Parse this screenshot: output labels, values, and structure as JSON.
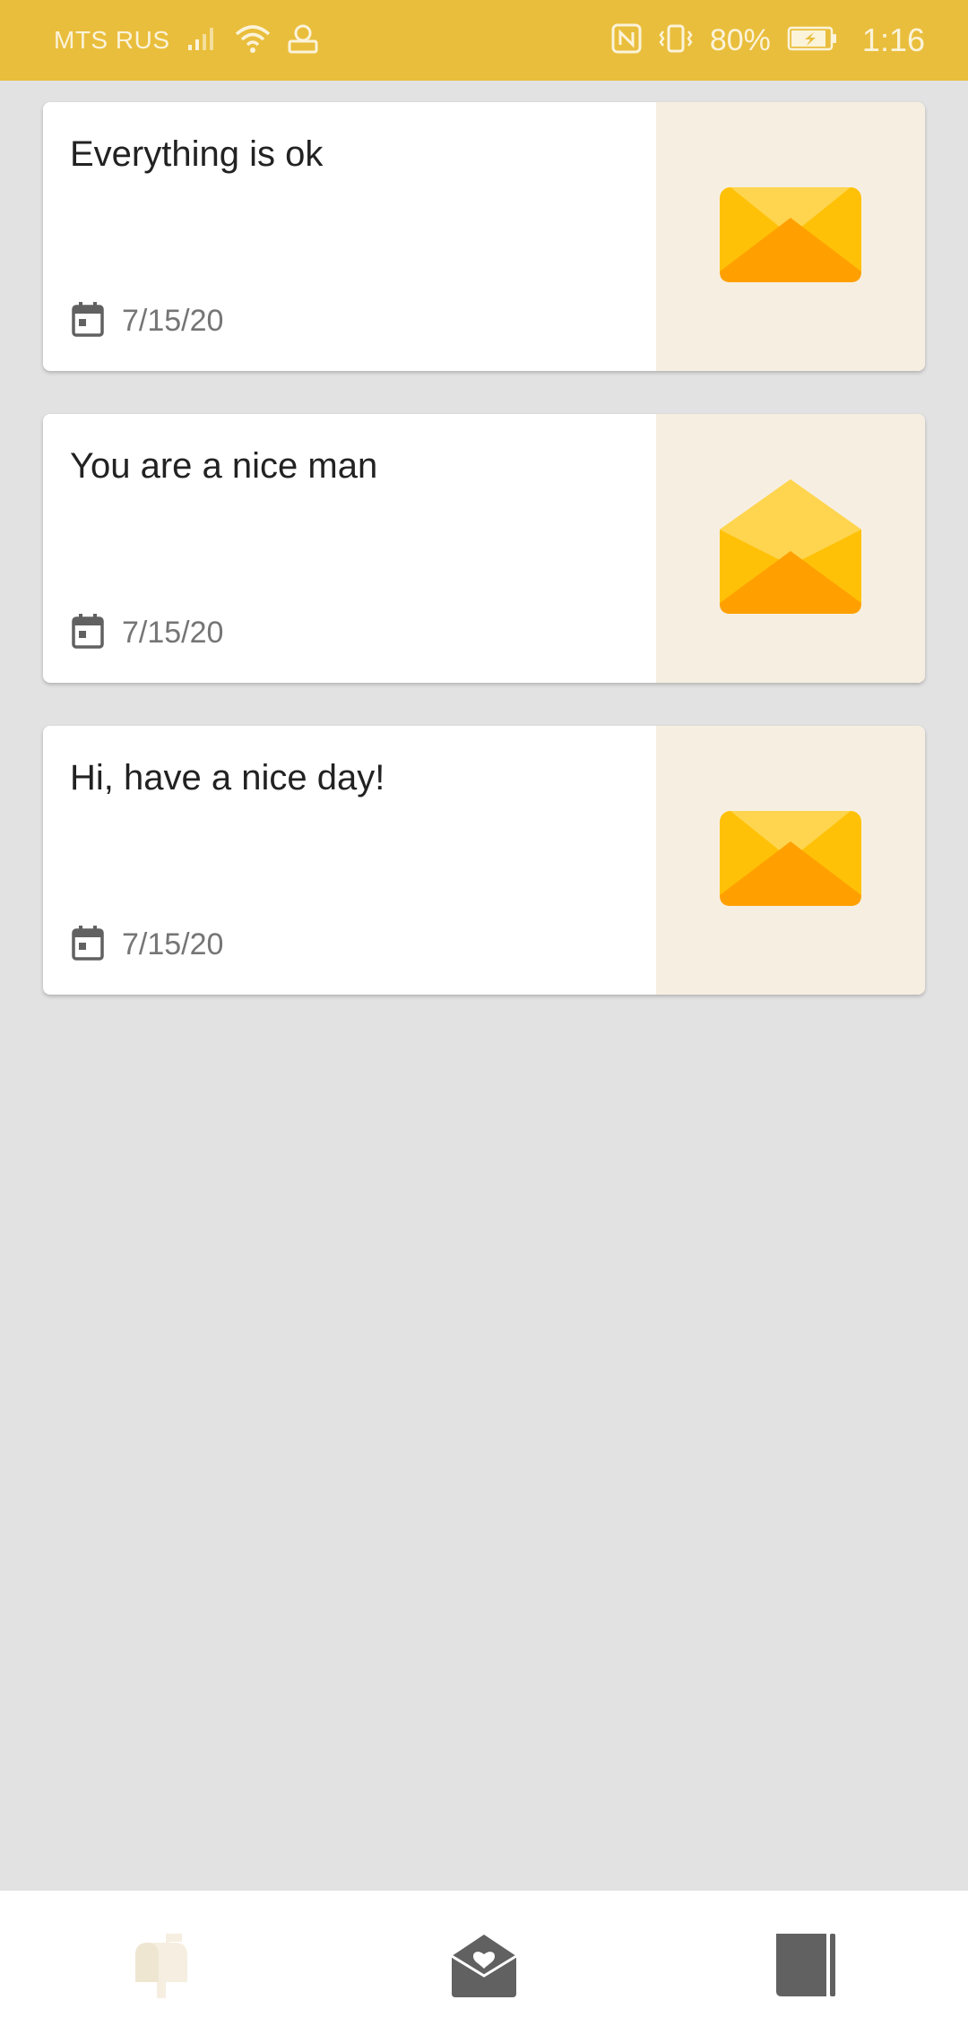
{
  "status_bar": {
    "carrier": "MTS RUS",
    "battery": "80%",
    "time": "1:16"
  },
  "messages": [
    {
      "title": "Everything is ok",
      "date": "7/15/20",
      "icon": "closed-envelope-icon"
    },
    {
      "title": "You are a nice man",
      "date": "7/15/20",
      "icon": "open-envelope-icon"
    },
    {
      "title": "Hi, have a nice day!",
      "date": "7/15/20",
      "icon": "closed-envelope-icon"
    }
  ],
  "bottom_nav": {
    "items": [
      {
        "icon": "mailbox-icon",
        "active": true
      },
      {
        "icon": "love-letter-icon",
        "active": false
      },
      {
        "icon": "notebook-icon",
        "active": false
      }
    ]
  },
  "colors": {
    "status_bar": "#e9be3c",
    "background": "#e2e2e2",
    "card_side": "#f6efe1",
    "envelope_light": "#ffd54f",
    "envelope_mid": "#ffc107",
    "envelope_dark": "#ffa000",
    "icon_grey": "#616161"
  }
}
